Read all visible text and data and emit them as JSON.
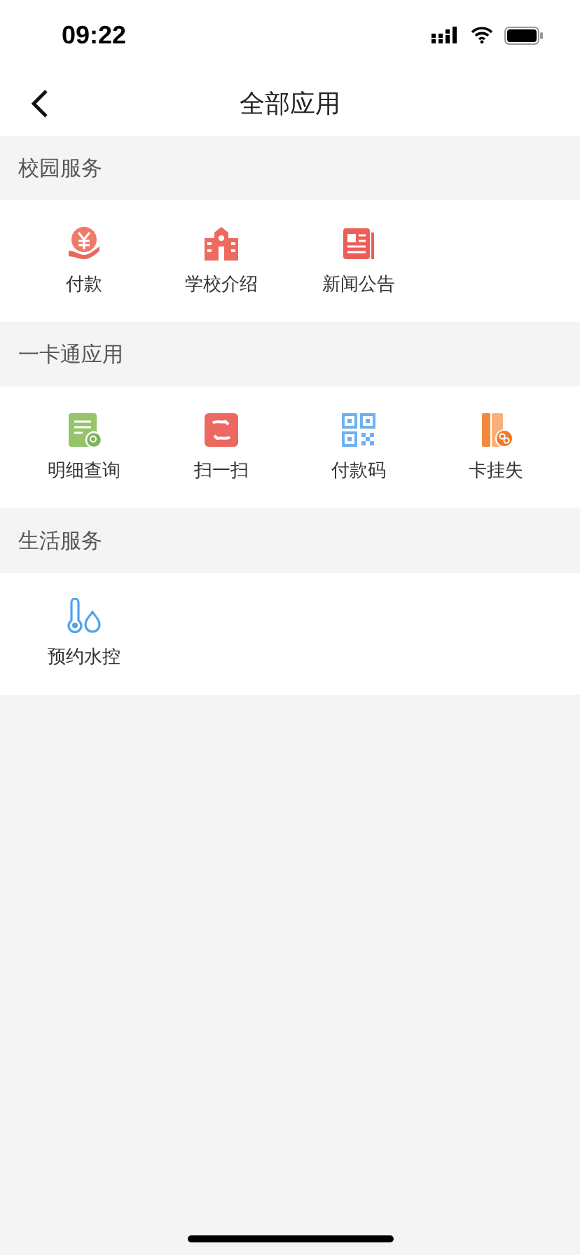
{
  "status_bar": {
    "time": "09:22"
  },
  "nav": {
    "title": "全部应用"
  },
  "sections": [
    {
      "title": "校园服务",
      "apps": [
        {
          "label": "付款",
          "kind": "pay"
        },
        {
          "label": "学校介绍",
          "kind": "school"
        },
        {
          "label": "新闻公告",
          "kind": "news"
        }
      ]
    },
    {
      "title": "一卡通应用",
      "apps": [
        {
          "label": "明细查询",
          "kind": "detail"
        },
        {
          "label": "扫一扫",
          "kind": "scan"
        },
        {
          "label": "付款码",
          "kind": "qr"
        },
        {
          "label": "卡挂失",
          "kind": "lost"
        }
      ]
    },
    {
      "title": "生活服务",
      "apps": [
        {
          "label": "预约水控",
          "kind": "water"
        }
      ]
    }
  ]
}
